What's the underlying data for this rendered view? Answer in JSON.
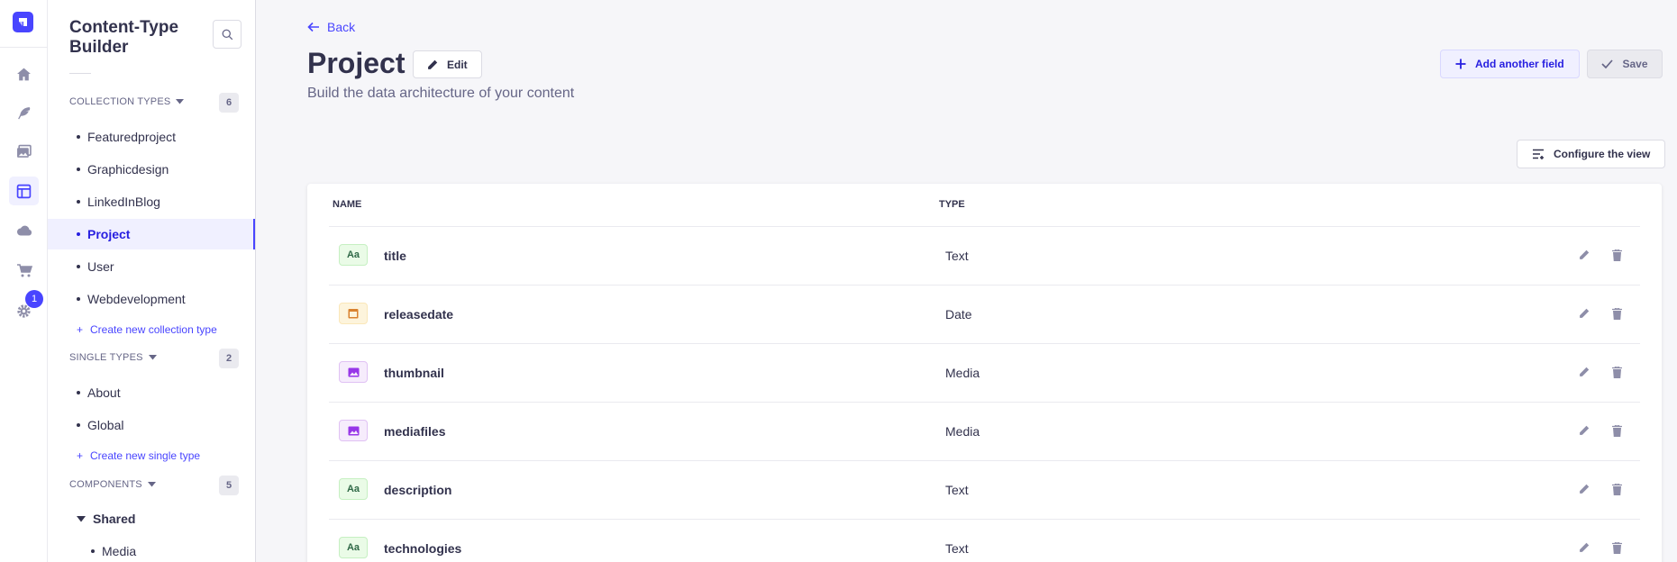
{
  "colors": {
    "primary": "#4945ff",
    "text": "#32324d",
    "muted": "#666687"
  },
  "rail": {
    "notification_count": "1",
    "icons": [
      "home-icon",
      "feather-icon",
      "image-icon",
      "layout-icon",
      "cloud-icon",
      "cart-icon",
      "gear-icon"
    ]
  },
  "subnav": {
    "title": "Content-Type Builder",
    "collection_types": {
      "label": "COLLECTION TYPES",
      "count": "6",
      "items": [
        {
          "label": "Featuredproject"
        },
        {
          "label": "Graphicdesign"
        },
        {
          "label": "LinkedInBlog"
        },
        {
          "label": "Project",
          "active": true
        },
        {
          "label": "User"
        },
        {
          "label": "Webdevelopment"
        }
      ],
      "create_label": "Create new collection type"
    },
    "single_types": {
      "label": "SINGLE TYPES",
      "count": "2",
      "items": [
        {
          "label": "About"
        },
        {
          "label": "Global"
        }
      ],
      "create_label": "Create new single type"
    },
    "components": {
      "label": "COMPONENTS",
      "count": "5",
      "group": "Shared",
      "items": [
        {
          "label": "Media"
        }
      ]
    }
  },
  "header": {
    "back_label": "Back",
    "title": "Project",
    "edit_label": "Edit",
    "subtitle": "Build the data architecture of your content",
    "add_field_label": "Add another field",
    "save_label": "Save",
    "configure_label": "Configure the view"
  },
  "table": {
    "columns": [
      "NAME",
      "TYPE"
    ],
    "rows": [
      {
        "name": "title",
        "type": "Text",
        "icon": "text-icon",
        "icon_glyph": "Aa"
      },
      {
        "name": "releasedate",
        "type": "Date",
        "icon": "date-icon",
        "icon_glyph": ""
      },
      {
        "name": "thumbnail",
        "type": "Media",
        "icon": "media-icon",
        "icon_glyph": ""
      },
      {
        "name": "mediafiles",
        "type": "Media",
        "icon": "media-icon",
        "icon_glyph": ""
      },
      {
        "name": "description",
        "type": "Text",
        "icon": "text-icon",
        "icon_glyph": "Aa"
      },
      {
        "name": "technologies",
        "type": "Text",
        "icon": "text-icon",
        "icon_glyph": "Aa"
      }
    ]
  }
}
